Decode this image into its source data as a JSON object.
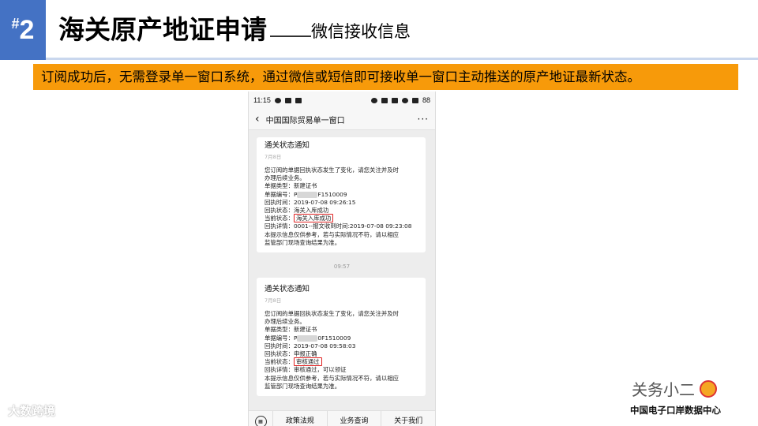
{
  "slide": {
    "badge_hash": "#",
    "badge_number": "2",
    "title": "海关原产地证申请",
    "subtitle": "微信接收信息",
    "banner": "订阅成功后，无需登录单一窗口系统，通过微信或短信即可接收单一窗口主动推送的原产地证最新状态。",
    "watermark_left": "大数跨境",
    "brand_name": "关务小二",
    "brand_sub": "中国电子口岸数据中心"
  },
  "phone": {
    "status": {
      "time": "11:15",
      "battery": "88"
    },
    "nav": {
      "back": "‹",
      "title": "中国国际贸易单一窗口",
      "more": "···"
    },
    "timestamp": "09:57",
    "messages": [
      {
        "title": "通关状态通知",
        "date": "7月8日",
        "intro1": "您订阅的单据回执状态发生了变化，请您关注并及时",
        "intro2": "办理后续业务。",
        "type": "单据类型：新建证书",
        "number_prefix": "单据编号：P",
        "number_suffix": "F1510009",
        "time": "回执时间：2019-07-08 09:26:15",
        "receipt_status": "回执状态：海关入库成功",
        "current_label": "当前状态：",
        "current_value": "海关入库成功",
        "detail": "回执详情：0001--报文收到时间:2019-07-08 09:23:08",
        "note1": "本提示信息仅供参考，若与实际情况不符，请以相应",
        "note2": "监管部门现场查询结果为准。"
      },
      {
        "title": "通关状态通知",
        "date": "7月8日",
        "intro1": "您订阅的单据回执状态发生了变化，请您关注并及时",
        "intro2": "办理后续业务。",
        "type": "单据类型：新建证书",
        "number_prefix": "单据编号：P",
        "number_suffix": "0F1510009",
        "time": "回执时间：2019-07-08 09:58:03",
        "receipt_status": "回执状态：申报正确",
        "current_label": "当前状态：",
        "current_value": "审核通过",
        "detail": "回执详情：审核通过，可以领证",
        "note1": "本提示信息仅供参考，若与实际情况不符，请以相应",
        "note2": "监管部门现场查询结果为准。"
      }
    ],
    "menu": [
      "政策法规",
      "业务查询",
      "关于我们"
    ]
  }
}
